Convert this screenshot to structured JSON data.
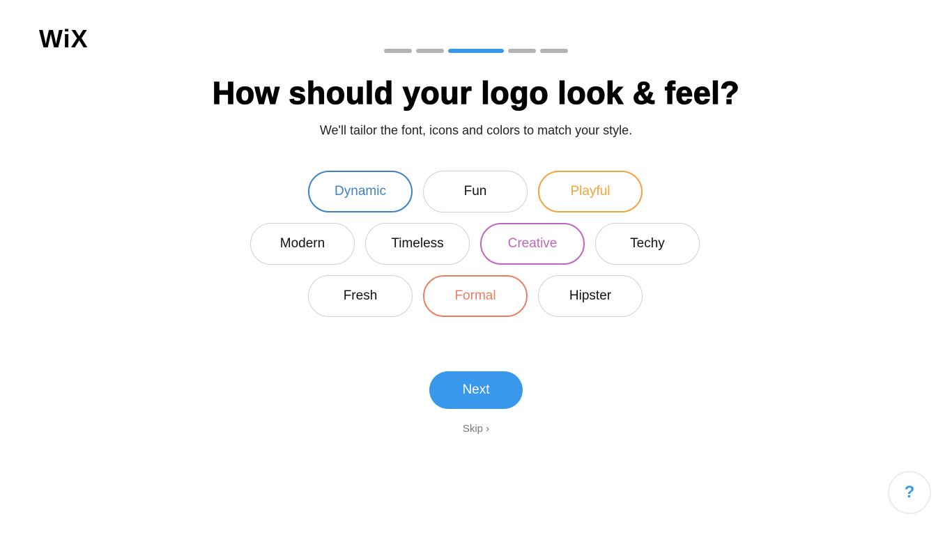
{
  "brand": {
    "logo_text": "WiX"
  },
  "progress": {
    "total_steps": 5,
    "current_step": 3
  },
  "header": {
    "title": "How should your logo look & feel?",
    "subtitle": "We'll tailor the font, icons and colors to match your style."
  },
  "styles": [
    {
      "label": "Dynamic",
      "selected": true,
      "color": "#3b82c8"
    },
    {
      "label": "Fun",
      "selected": false,
      "color": "#111111"
    },
    {
      "label": "Playful",
      "selected": true,
      "color": "#f3a33c"
    },
    {
      "label": "Modern",
      "selected": false,
      "color": "#111111"
    },
    {
      "label": "Timeless",
      "selected": false,
      "color": "#111111"
    },
    {
      "label": "Creative",
      "selected": true,
      "color": "#c066c0"
    },
    {
      "label": "Techy",
      "selected": false,
      "color": "#111111"
    },
    {
      "label": "Fresh",
      "selected": false,
      "color": "#111111"
    },
    {
      "label": "Formal",
      "selected": true,
      "color": "#ef7d63"
    },
    {
      "label": "Hipster",
      "selected": false,
      "color": "#111111"
    }
  ],
  "actions": {
    "next_label": "Next",
    "skip_label": "Skip",
    "skip_icon": "chevron-right-icon"
  },
  "help": {
    "label": "?",
    "icon": "help-icon"
  },
  "colors": {
    "accent": "#3899ec",
    "inactive_segment": "#b3b3b3"
  }
}
